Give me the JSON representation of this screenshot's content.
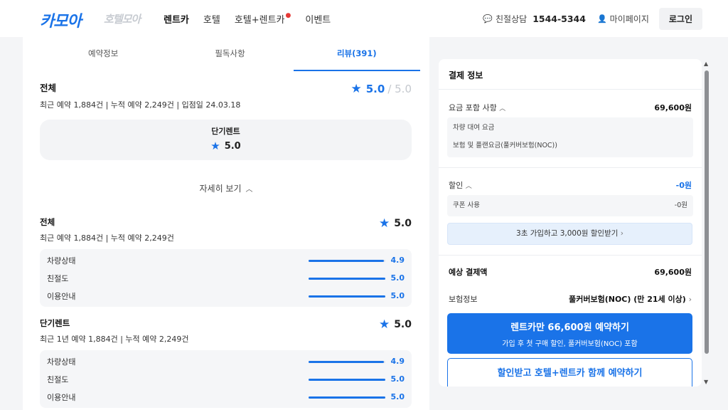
{
  "header": {
    "logo": "카모아",
    "logo_sub": "호텔모아",
    "nav": [
      "렌트카",
      "호텔",
      "호텔+렌트카",
      "이벤트"
    ],
    "consult_label": "친절상담",
    "phone": "1544-5344",
    "mypage": "마이페이지",
    "login": "로그인"
  },
  "tabs": [
    "예약정보",
    "필독사항",
    "리뷰(391)"
  ],
  "summary": {
    "title": "전체",
    "stats": "최근 예약 1,884건 | 누적 예약 2,249건 | 입점일 24.03.18",
    "score": "5.0",
    "max": "/ 5.0"
  },
  "rent_box": {
    "label": "단기렌트",
    "score": "5.0"
  },
  "more_label": "자세히 보기",
  "blocks": [
    {
      "title": "전체",
      "sub": "최근 예약 1,884건 | 누적 예약 2,249건",
      "score": "5.0",
      "rows": [
        {
          "label": "차량상태",
          "value": "4.9",
          "ratio": 0.98
        },
        {
          "label": "친절도",
          "value": "5.0",
          "ratio": 1.0
        },
        {
          "label": "이용안내",
          "value": "5.0",
          "ratio": 1.0
        }
      ]
    },
    {
      "title": "단기렌트",
      "sub": "최근 1년 예약 1,884건 | 누적 예약 2,249건",
      "score": "5.0",
      "rows": [
        {
          "label": "차량상태",
          "value": "4.9",
          "ratio": 0.98
        },
        {
          "label": "친절도",
          "value": "5.0",
          "ratio": 1.0
        },
        {
          "label": "이용안내",
          "value": "5.0",
          "ratio": 1.0
        }
      ]
    }
  ],
  "payment": {
    "title": "결제 정보",
    "fee_label": "요금 포함 사항",
    "fee_amount": "69,600원",
    "fee_items": [
      "차량 대여 요금",
      "보험 및 플랜요금(풀커버보험(NOC))"
    ],
    "discount_label": "할인",
    "discount_amount": "-0원",
    "coupon_label": "쿠폰 사용",
    "coupon_amount": "-0원",
    "promo": "3초 가입하고 3,000원 할인받기",
    "expected_label": "예상 결제액",
    "expected_amount": "69,600원",
    "insurance_label": "보험정보",
    "insurance_value": "풀커버보험(NOC) (만 21세 이상)",
    "cta1_line1": "렌트카만 66,600원 예약하기",
    "cta1_line2": "가입 후 첫 구매 할인, 풀커버보험(NOC) 포함",
    "cta2_line1": "할인받고 호텔+렌트카 함께 예약하기"
  },
  "colors": {
    "accent": "#1a73e8",
    "alert": "#e53935"
  }
}
